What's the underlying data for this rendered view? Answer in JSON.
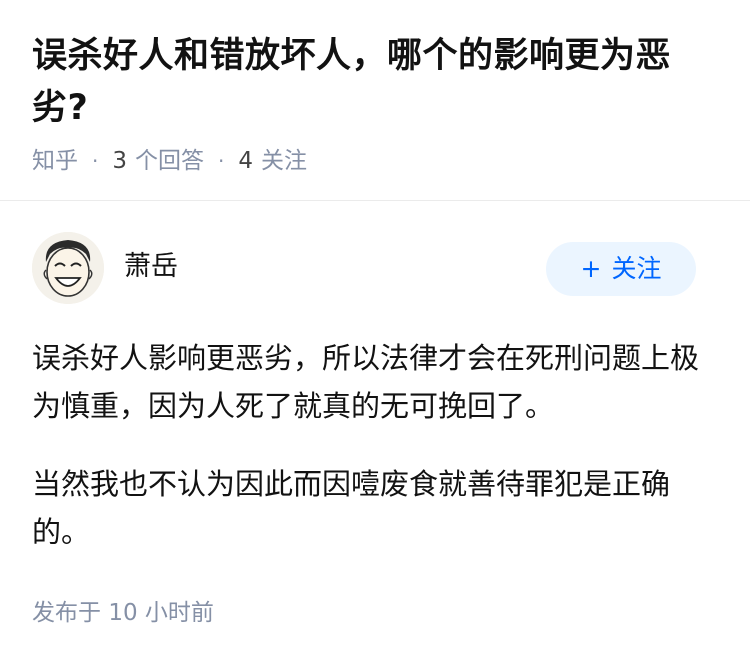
{
  "question": {
    "title": "误杀好人和错放坏人，哪个的影响更为恶劣?",
    "source": "知乎",
    "answer_count": "3",
    "answer_label": "个回答",
    "follower_count": "4",
    "follower_label": "关注"
  },
  "answer": {
    "author": {
      "name": "萧岳",
      "avatar_icon": "cartoon-face-icon"
    },
    "follow_button": {
      "icon": "+",
      "label": "关注",
      "color": "#0066ff",
      "background": "#ebf5ff"
    },
    "paragraphs": [
      "误杀好人影响更恶劣，所以法律才会在死刑问题上极为慎重，因为人死了就真的无可挽回了。",
      "当然我也不认为因此而因噎废食就善待罪犯是正确的。"
    ],
    "published_label": "发布于",
    "published_time": "10 小时前"
  }
}
